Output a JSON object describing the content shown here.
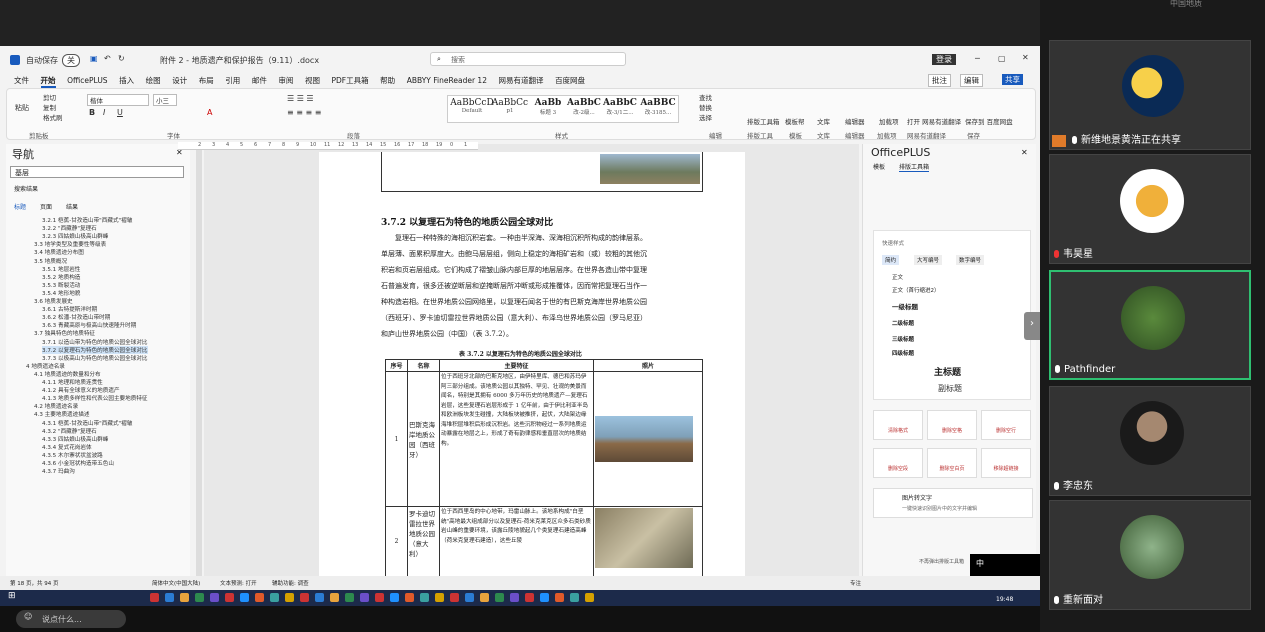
{
  "word": {
    "autosave": "自动保存",
    "autosave_state": "关",
    "doc_title": "附件 2 - 地质遗产和保护报告（9.11）.docx",
    "search_placeholder": "搜索",
    "login": "登录",
    "menu": [
      "文件",
      "开始",
      "OfficePLUS",
      "插入",
      "绘图",
      "设计",
      "布局",
      "引用",
      "邮件",
      "审阅",
      "视图",
      "PDF工具箱",
      "帮助",
      "ABBYY FineReader 12",
      "网易有道翻译",
      "百度网盘"
    ],
    "comment_btn": "批注",
    "edit_btn": "编辑",
    "share_btn": "共享",
    "ribbon": {
      "paste": "粘贴",
      "cut": "剪切",
      "copy": "复制",
      "format_painter": "格式刷",
      "clipboard": "剪贴板",
      "font_name": "楷体",
      "font_size": "小三",
      "font": "字体",
      "paragraph": "段落",
      "styles_label": "样式",
      "styles": [
        {
          "preview": "AaBbCcD",
          "name": "Default"
        },
        {
          "preview": "AaBbCc",
          "name": "p1"
        },
        {
          "preview": "AaBb",
          "name": "标题 3"
        },
        {
          "preview": "AaBbC",
          "name": "改-2级..."
        },
        {
          "preview": "AaBbC",
          "name": "改-3/1二..."
        },
        {
          "preview": "AaBBC",
          "name": "改-3185..."
        }
      ],
      "find": "查找",
      "replace": "替换",
      "select": "选择",
      "edit": "编辑",
      "layout_tool": "排版工具箱",
      "template": "模板帮",
      "library": "文库",
      "editor": "编辑器",
      "new_grp": "加载项",
      "open_youdao": "打开 网易有道翻译",
      "save_baidu": "保存到 百度网盘",
      "tg1": "排版工具",
      "tg2": "模板",
      "tg3": "文库",
      "tg4": "编辑器",
      "tg5": "加载项",
      "tg6": "网易有道翻译",
      "tg7": "保存"
    },
    "nav": {
      "title": "导航",
      "search_value": "基层",
      "results_label": "搜索结果",
      "tabs": [
        "标题",
        "页面",
        "结果"
      ],
      "items": [
        "3.2.1 桤蕉-甘孜造山带\"西藏式\"褶皱",
        "3.2.2 \"西藏静\"复理石",
        "3.2.3 四姑娘山极高山群峰",
        "3.3 地学类型及重要性等级表",
        "3.4 地质遗迹分布图",
        "3.5 地质概况",
        "3.5.1 地层岩性",
        "3.5.2 地质构造",
        "3.5.3 断裂活动",
        "3.5.4 地形地貌",
        "3.6 地质发展史",
        "3.6.1 古特提斯洋时期",
        "3.6.2 松潘-甘孜造山带时期",
        "3.6.3 青藏高原与极高山快速隆升时期",
        "3.7 独具特色的地质特征",
        "3.7.1 以造山带为特色的地质公园全球对比",
        "3.7.2 以复理石为特色的地质公园全球对比",
        "3.7.3 以极高山为特色的地质公园全球对比",
        "4 地质遗迹名录",
        "4.1 地质遗迹的数量和分布",
        "4.1.1 地理和地质连贯性",
        "4.1.2 具有全球意义的地质遗产",
        "4.1.3 地质多样性和代表公园主要地质特征",
        "4.2 地质遗迹名录",
        "4.3 主要地质遗迹描述",
        "4.3.1 桤蕉-甘孜造山带\"西藏式\"褶皱",
        "4.3.2 \"西藏静\"复理石",
        "4.3.3 四姑娘山极高山群峰",
        "4.3.4 复式花岗岩体",
        "4.3.5 木尔寨状状盆波路",
        "4.3.6 小金冠状构造带五色山",
        "4.3.7 玛曲沟"
      ]
    },
    "doc": {
      "heading": "3.7.2  以复理石为特色的地质公园全球对比",
      "para": [
        "复理石一种特殊的海相沉积岩套。一种由半深海、深海相沉积所构成的韵律层系。",
        "单层薄、面累积厚度大。由鲍马层层组，侧向上稳定的海相矿岩和（或）较粗的其他沉",
        "积岩和页岩层组成。它们构成了褶皱山脉内部巨厚的地层层序。在世界各造山带中复理",
        "石普遍发育，很多还被逆断层和逆掩断层所冲断或形成推覆体，因而常把复理石当作一",
        "种构造岩相。在世界地质公园网络里，以复理石闻名于世的有巴斯克海岸世界地质公园",
        "（西班牙）、罗卡迪切雷拉世界地质公园（意大利）、布泽乌世界地质公园（罗马尼亚）",
        "和庐山世界地质公园（中国）（表 3.7.2）。"
      ],
      "table_caption": "表 3.7.2  以复理石为特色的地质公园全球对比",
      "columns": [
        "序号",
        "名称",
        "主要特征",
        "照片"
      ],
      "rows": [
        {
          "no": "1",
          "name": "巴斯克海岸地质公园（西班牙）",
          "desc": "位于西班牙北部的巴斯克地区，由伊特里库、德巴和苏玛伊阿三部分组成。该地质公园以其独特、罕见、壮观的美景而闻名，特别是其拥有 6000 多万年历史的地质遗产—复理石岩层，这些复理石岩层形成于 1 亿年前，由于伊比利亚半岛和欧洲板块发生碰撞，大陆板块被推挤，起伏，大陆架边缘海堆积层堆积后形成沉积岩。这些沉积物经过一系列地质运动暴露在地层之上，形成了奇有韵律感和垂直层次的地质结构。"
        },
        {
          "no": "2",
          "name": "罗卡迪切雷拉世界地质公园（意大利）",
          "desc": "位于西西里岛的中心地带，玛雷山脉上。该地系构成\"白垩统\"高地最大组成部分以及复理石-荷米克莱克区众多石类砂质岩山峰的重要环境，该露丘陵地貌起几个类复理石建造高峰（荷米克复理石建造），这些丘陵"
        }
      ]
    },
    "panel": {
      "title": "OfficePLUS",
      "tabs": [
        "模板",
        "排版工具箱"
      ],
      "quick": "快速样式",
      "numbering": [
        "简约",
        "大写编号",
        "数字编号"
      ],
      "styles": [
        "正文",
        "正文（首行缩进2）",
        "一级标题",
        "二级标题",
        "三级标题",
        "四级标题"
      ],
      "main_title": "主标题",
      "sub_title": "副标题",
      "buttons": [
        "清除格式",
        "删除空格",
        "删除空行",
        "删除空段",
        "删除空白页",
        "移除超链接"
      ],
      "img2text": "图片转文字",
      "img2text_sub": "一键快速识别图片中的文字并编辑",
      "dont_show": "不再弹出排版工具箱"
    },
    "status": {
      "page": "第 18 页，共 94 页",
      "lang": "简体中文(中国大陆)",
      "predict": "文本预测: 打开",
      "access": "辅助功能: 调查",
      "focus": "专注",
      "ime": "中"
    },
    "taskbar": {
      "search": "说点什么...",
      "time": "19:48"
    }
  },
  "participants": [
    {
      "name": "新维地景黄浩正在共享",
      "sharing": true
    },
    {
      "name": "韦昊星"
    },
    {
      "name": "Pathfinder",
      "active": true
    },
    {
      "name": "李忠东"
    },
    {
      "name": "重新面对"
    }
  ],
  "top_right_name": "中国地质",
  "colors": {
    "accent": "#185abd",
    "active_border": "#2fbf71"
  }
}
